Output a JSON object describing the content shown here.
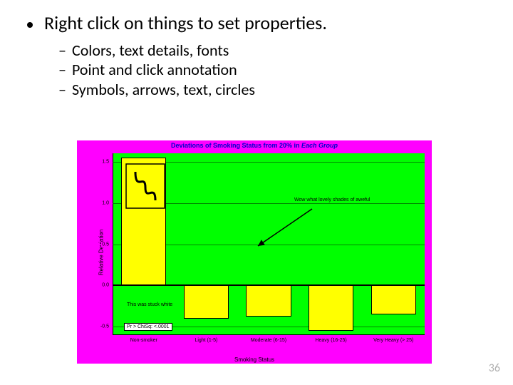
{
  "bullet": {
    "main": "Right click on things to set properties.",
    "subs": [
      "Colors, text details, fonts",
      "Point and click annotation",
      "Symbols, arrows, text, circles"
    ]
  },
  "page_number": "36",
  "chart": {
    "title_plain": "Deviations of Smoking Status from 20% in ",
    "title_italic": "Each Group",
    "ylabel": "Relative Deviation",
    "xlabel": "Smoking Status",
    "annot_top": "Wow what lovely shades of aweful",
    "annot_mid": "This was stuck white",
    "stat_text": "Pr > ChiSq:  <.0001"
  },
  "chart_data": {
    "type": "bar",
    "categories": [
      "Non-smoker",
      "Light (1-5)",
      "Moderate (6-15)",
      "Heavy (16-25)",
      "Very Heavy (> 25)"
    ],
    "values": [
      1.55,
      -0.4,
      -0.38,
      -0.55,
      -0.35
    ],
    "title": "Deviations of Smoking Status from 20% in Each Group",
    "xlabel": "Smoking Status",
    "ylabel": "Relative Deviation",
    "ylim": [
      -0.5,
      1.5
    ],
    "yticks": [
      -0.5,
      0.0,
      0.5,
      1.0,
      1.5
    ]
  }
}
